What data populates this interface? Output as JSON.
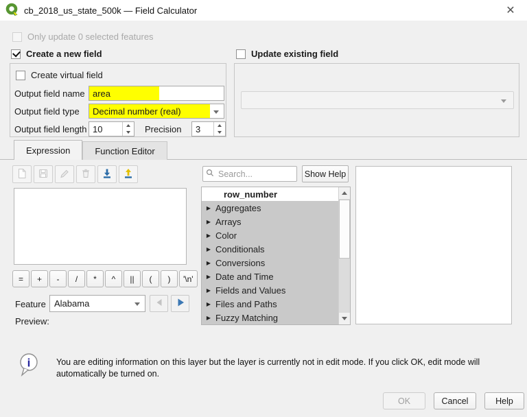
{
  "window": {
    "title": "cb_2018_us_state_500k — Field Calculator",
    "close_glyph": "✕"
  },
  "selection": {
    "only_update_label": "Only update 0 selected features"
  },
  "mode": {
    "create_new_field_label": "Create a new field",
    "update_existing_field_label": "Update existing field"
  },
  "new_field": {
    "create_virtual_field_label": "Create virtual field",
    "name_label": "Output field name",
    "name_value": "area",
    "type_label": "Output field type",
    "type_value": "Decimal number (real)",
    "length_label": "Output field length",
    "length_value": "10",
    "precision_label": "Precision",
    "precision_value": "3"
  },
  "tabs": {
    "expression": "Expression",
    "function_editor": "Function Editor"
  },
  "expression_panel": {
    "expression_value": "",
    "operators": [
      "=",
      "+",
      "-",
      "/",
      "*",
      "^",
      "||",
      "(",
      ")",
      "'\\n'"
    ],
    "feature_label": "Feature",
    "feature_value": "Alabama",
    "preview_label": "Preview:"
  },
  "function_panel": {
    "search_placeholder": "Search...",
    "show_help_label": "Show Help",
    "items": [
      {
        "label": "row_number"
      },
      {
        "label": "Aggregates"
      },
      {
        "label": "Arrays"
      },
      {
        "label": "Color"
      },
      {
        "label": "Conditionals"
      },
      {
        "label": "Conversions"
      },
      {
        "label": "Date and Time"
      },
      {
        "label": "Fields and Values"
      },
      {
        "label": "Files and Paths"
      },
      {
        "label": "Fuzzy Matching"
      }
    ]
  },
  "notice": {
    "text": "You are editing information on this layer but the layer is currently not in edit mode. If you click OK, edit mode will automatically be turned on."
  },
  "footer": {
    "ok": "OK",
    "cancel": "Cancel",
    "help": "Help"
  },
  "colors": {
    "highlight_yellow": "#ffff00",
    "selected_row_gray": "#c9c9c9",
    "accent_blue": "#3c78b4",
    "import_blue": "#2d6da8",
    "export_yellow": "#e3c000",
    "qgis_green": "#589632"
  }
}
